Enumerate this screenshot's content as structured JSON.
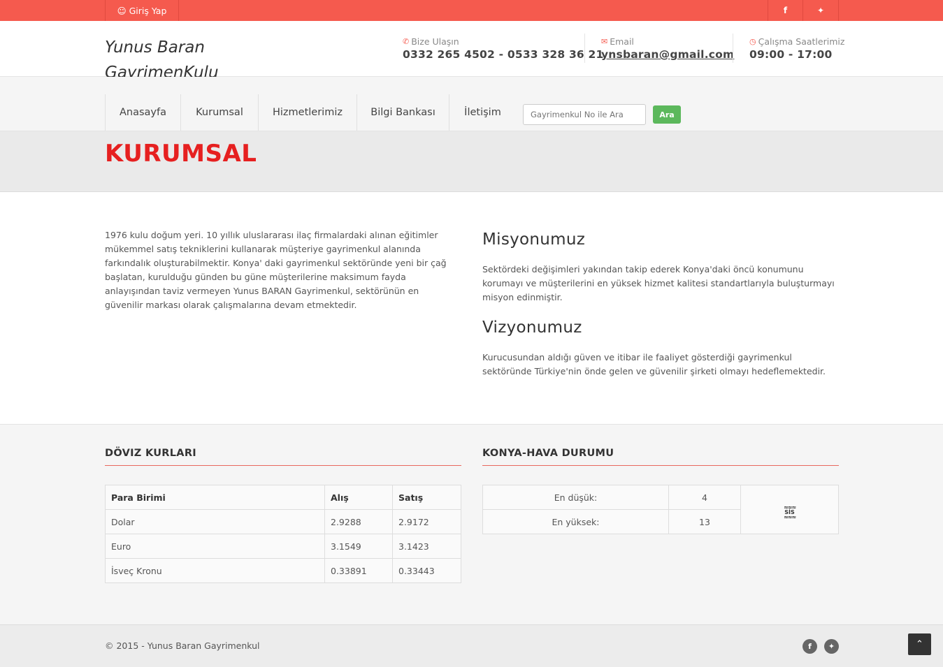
{
  "topbar": {
    "login_label": "Giriş Yap",
    "login_icon": "user-icon",
    "social": [
      "facebook-icon",
      "twitter-icon"
    ],
    "brand_color": "#f55a4e"
  },
  "header": {
    "logo_line1": "Yunus Baran",
    "logo_line2": "GayrimenKulu",
    "contact": {
      "phone_label": "Bize Ulaşın",
      "phone_value": "0332 265 4502 - 0533 328 36 21",
      "email_label": "Email",
      "email_value": "ynsbaran@gmail.com",
      "hours_label": "Çalışma Saatlerimiz",
      "hours_value": "09:00 - 17:00"
    }
  },
  "nav": {
    "items": [
      "Anasayfa",
      "Kurumsal",
      "Hizmetlerimiz",
      "Bilgi Bankası",
      "İletişim"
    ],
    "search_placeholder": "Gayrimenkul No ile Ara",
    "search_button": "Ara"
  },
  "page": {
    "title": "KURUMSAL",
    "about": "1976 kulu doğum yeri. 10 yıllık uluslararası ilaç firmalardaki alınan eğitimler mükemmel satış tekniklerini kullanarak müşteriye gayrimenkul alanında farkındalık oluşturabilmektir. Konya' daki gayrimenkul sektöründe yeni bir çağ başlatan, kurulduğu günden bu güne müşterilerine maksimum fayda anlayışından taviz vermeyen Yunus BARAN Gayrimenkul, sektörünün en güvenilir markası olarak çalışmalarına devam etmektedir.",
    "mission_title": "Misyonumuz",
    "mission_text": "Sektördeki değişimleri yakından takip ederek Konya'daki öncü konumunu korumayı ve müşterilerini en yüksek hizmet kalitesi standartlarıyla buluşturmayı misyon edinmiştir.",
    "vision_title": "Vizyonumuz",
    "vision_text": "Kurucusundan aldığı güven ve itibar ile faaliyet gösterdiği gayrimenkul sektöründe Türkiye'nin önde gelen ve güvenilir şirketi olmayı hedeflemektedir."
  },
  "currency": {
    "title": "DÖVIZ KURLARI",
    "headers": [
      "Para Birimi",
      "Alış",
      "Satış"
    ],
    "rows": [
      [
        "Dolar",
        "2.9288",
        "2.9172"
      ],
      [
        "Euro",
        "3.1549",
        "3.1423"
      ],
      [
        "İsveç Kronu",
        "0.33891",
        "0.33443"
      ]
    ]
  },
  "weather": {
    "title": "KONYA-HAVA DURUMU",
    "rows": [
      [
        "En düşük:",
        "4"
      ],
      [
        "En yüksek:",
        "13"
      ]
    ],
    "icon_text": "SİS",
    "icon_name": "fog-icon"
  },
  "footer": {
    "copyright": "© 2015 - Yunus Baran Gayrimenkul",
    "social": [
      "facebook-icon",
      "twitter-icon"
    ],
    "to_top": "chevron-up-icon"
  }
}
